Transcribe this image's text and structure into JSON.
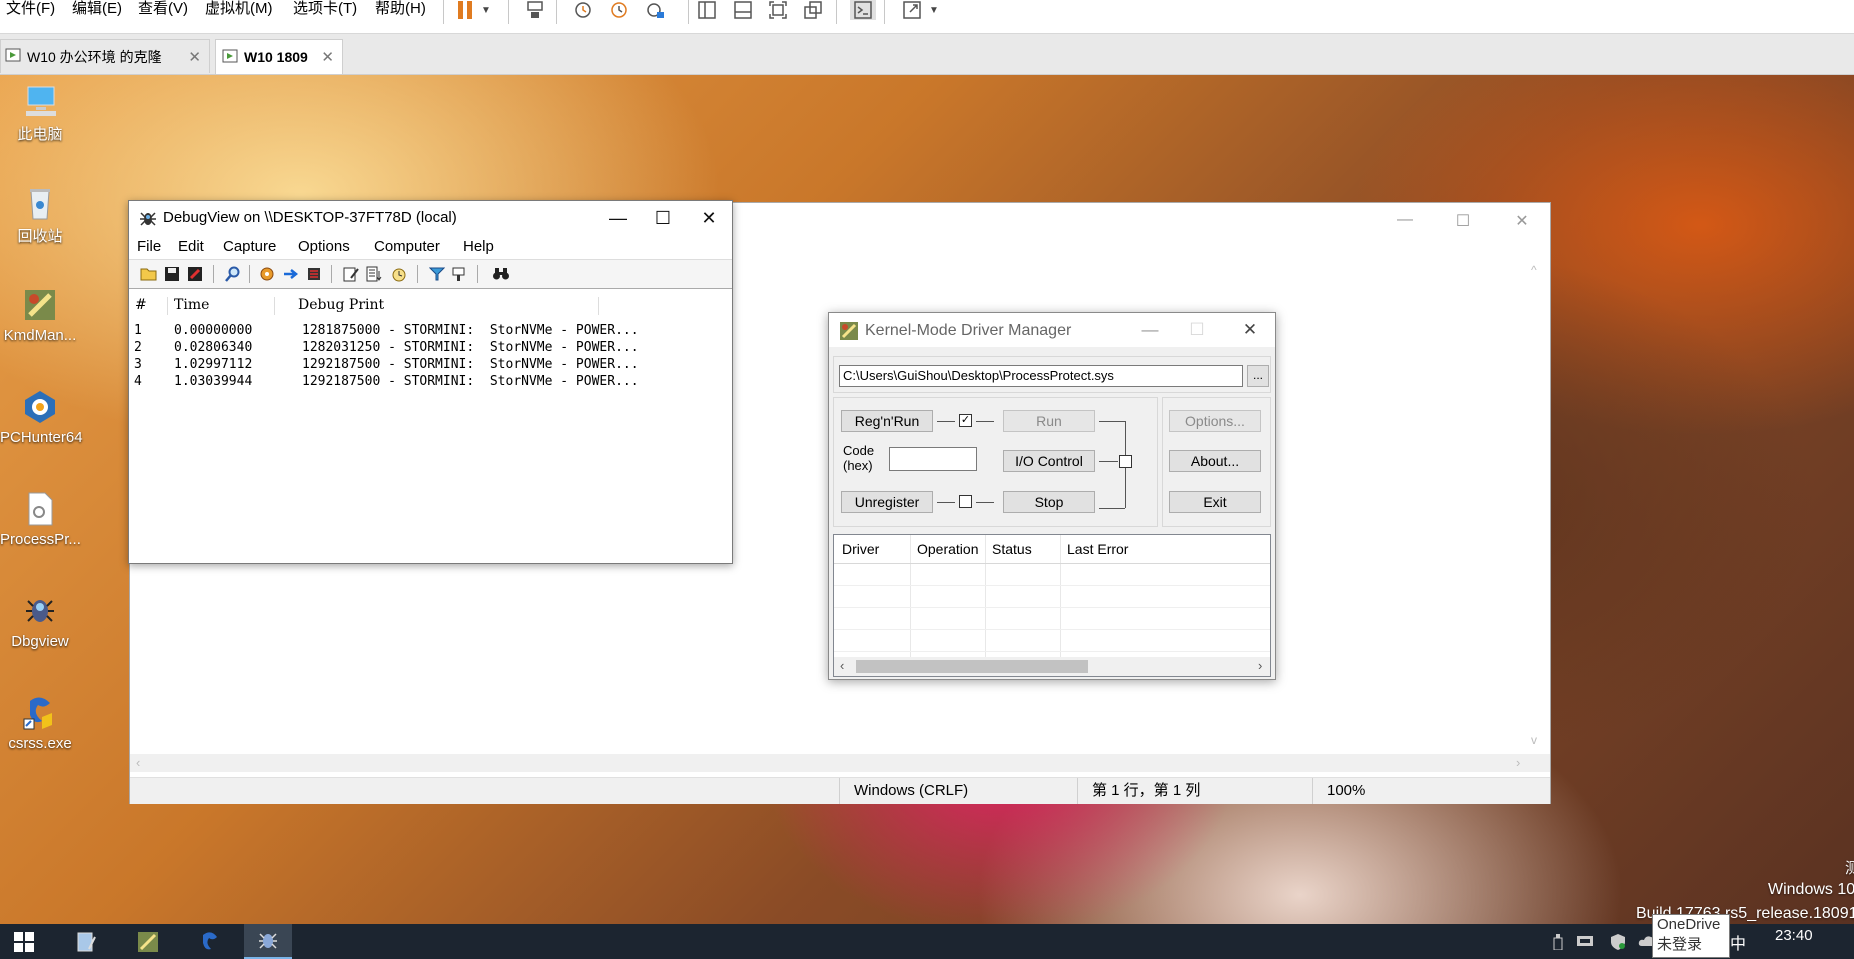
{
  "host_menu": {
    "items": [
      "文件(F)",
      "编辑(E)",
      "查看(V)",
      "虚拟机(M)",
      "选项卡(T)",
      "帮助(H)"
    ]
  },
  "host_toolbar": {
    "icons": [
      "pause-icon",
      "dropdown-arrow-icon",
      "send-keys-icon",
      "snapshot-icon",
      "revert-snapshot-icon",
      "snapshot-manager-icon",
      "sidebar-icon",
      "thumbnail-icon",
      "full-screen-icon",
      "unity-icon",
      "console-icon",
      "stretch-icon"
    ]
  },
  "vm_tabs": [
    {
      "label": "W10 办公环境 的克隆",
      "active": false
    },
    {
      "label": "W10 1809",
      "active": true
    }
  ],
  "desktop_icons": [
    "此电脑",
    "回收站",
    "KmdMan...",
    "PCHunter64",
    "ProcessPr...",
    "Dbgview",
    "csrss.exe"
  ],
  "debugview": {
    "title": "DebugView on \\\\DESKTOP-37FT78D (local)",
    "menu": [
      "File",
      "Edit",
      "Capture",
      "Options",
      "Computer",
      "Help"
    ],
    "columns": [
      "#",
      "Time",
      "Debug Print"
    ],
    "rows": [
      {
        "n": "1",
        "time": "0.00000000",
        "msg": "1281875000 - STORMINI:  StorNVMe - POWER..."
      },
      {
        "n": "2",
        "time": "0.02806340",
        "msg": "1282031250 - STORMINI:  StorNVMe - POWER..."
      },
      {
        "n": "3",
        "time": "1.02997112",
        "msg": "1292187500 - STORMINI:  StorNVMe - POWER..."
      },
      {
        "n": "4",
        "time": "1.03039944",
        "msg": "1292187500 - STORMINI:  StorNVMe - POWER..."
      }
    ]
  },
  "notepad": {
    "status_encoding": "Windows (CRLF)",
    "status_position": "第 1 行，第 1 列",
    "status_zoom": "100%"
  },
  "kmdm": {
    "title": "Kernel-Mode Driver Manager",
    "path": "C:\\Users\\GuiShou\\Desktop\\ProcessProtect.sys",
    "browse_label": "...",
    "reg_run": "Reg'n'Run",
    "run": "Run",
    "code_label_1": "Code",
    "code_label_2": "(hex)",
    "io_control": "I/O Control",
    "unregister": "Unregister",
    "stop": "Stop",
    "options": "Options...",
    "about": "About...",
    "exit": "Exit",
    "list_columns": [
      "Driver",
      "Operation",
      "Status",
      "Last Error"
    ]
  },
  "taskbar": {
    "onedrive_title": "OneDrive",
    "onedrive_status": "未登录",
    "time": "23:40",
    "ime": "中"
  },
  "watermark": {
    "line1": "测",
    "line2": "Windows 10",
    "line3": "Build 17763.rs5_release.18091"
  }
}
